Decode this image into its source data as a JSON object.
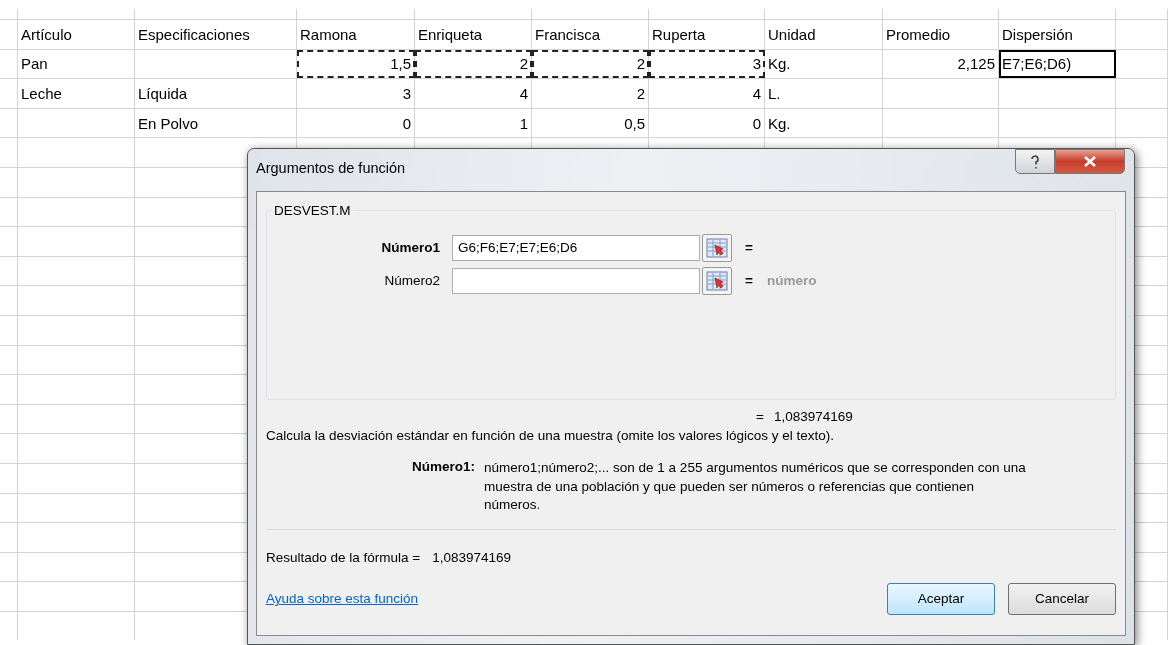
{
  "sheet": {
    "rows": [
      {
        "cells": [
          {
            "text": "Artículo",
            "kind": "text",
            "marked": false,
            "active": false
          },
          {
            "text": "Especificaciones",
            "kind": "text",
            "marked": false,
            "active": false
          },
          {
            "text": "Ramona",
            "kind": "text",
            "marked": false,
            "active": false
          },
          {
            "text": "Enriqueta",
            "kind": "text",
            "marked": false,
            "active": false
          },
          {
            "text": "Francisca",
            "kind": "text",
            "marked": false,
            "active": false
          },
          {
            "text": "Ruperta",
            "kind": "text",
            "marked": false,
            "active": false
          },
          {
            "text": "Unidad",
            "kind": "text",
            "marked": false,
            "active": false
          },
          {
            "text": "Promedio",
            "kind": "text",
            "marked": false,
            "active": false
          },
          {
            "text": "Dispersión",
            "kind": "text",
            "marked": false,
            "active": false
          }
        ]
      },
      {
        "cells": [
          {
            "text": "Pan",
            "kind": "text",
            "marked": false,
            "active": false
          },
          {
            "kind": "empty",
            "marked": false,
            "active": false
          },
          {
            "text": "1,5",
            "kind": "number",
            "marked": true,
            "active": false
          },
          {
            "text": "2",
            "kind": "number",
            "marked": true,
            "active": false
          },
          {
            "text": "2",
            "kind": "number",
            "marked": true,
            "active": false
          },
          {
            "text": "3",
            "kind": "number",
            "marked": true,
            "active": false
          },
          {
            "text": "Kg.",
            "kind": "text",
            "marked": false,
            "active": false
          },
          {
            "text": "2,125",
            "kind": "number",
            "marked": false,
            "active": false
          },
          {
            "text": "E7;E6;D6)",
            "kind": "text",
            "marked": false,
            "active": true
          }
        ]
      },
      {
        "cells": [
          {
            "text": "Leche",
            "kind": "text",
            "marked": false,
            "active": false
          },
          {
            "text": "Líquida",
            "kind": "text",
            "marked": false,
            "active": false
          },
          {
            "text": "3",
            "kind": "number",
            "marked": false,
            "active": false
          },
          {
            "text": "4",
            "kind": "number",
            "marked": false,
            "active": false
          },
          {
            "text": "2",
            "kind": "number",
            "marked": false,
            "active": false
          },
          {
            "text": "4",
            "kind": "number",
            "marked": false,
            "active": false
          },
          {
            "text": "L.",
            "kind": "text",
            "marked": false,
            "active": false
          },
          {
            "kind": "empty",
            "marked": false,
            "active": false
          },
          {
            "kind": "empty",
            "marked": false,
            "active": false
          }
        ]
      },
      {
        "cells": [
          {
            "kind": "empty",
            "marked": false,
            "active": false
          },
          {
            "text": "En Polvo",
            "kind": "text",
            "marked": false,
            "active": false
          },
          {
            "text": "0",
            "kind": "number",
            "marked": false,
            "active": false
          },
          {
            "text": "1",
            "kind": "number",
            "marked": false,
            "active": false
          },
          {
            "text": "0,5",
            "kind": "number",
            "marked": false,
            "active": false
          },
          {
            "text": "0",
            "kind": "number",
            "marked": false,
            "active": false
          },
          {
            "text": "Kg.",
            "kind": "text",
            "marked": false,
            "active": false
          },
          {
            "kind": "empty",
            "marked": false,
            "active": false
          },
          {
            "kind": "empty",
            "marked": false,
            "active": false
          }
        ]
      }
    ]
  },
  "dialog": {
    "title": "Argumentos de función",
    "function_name": "DESVEST.M",
    "arguments": [
      {
        "label": "Número1",
        "value": "G6;F6;E7;E7;E6;D6",
        "current": true,
        "equals": "="
      },
      {
        "label": "Número2",
        "current": false,
        "equals": "=",
        "hint": "número"
      }
    ],
    "result_line": {
      "equals": "=",
      "value": "1,083974169"
    },
    "description": "Calcula la desviación estándar en función de una muestra (omite los valores lógicos y el texto).",
    "argument_help": {
      "label": "Número1:",
      "text": "número1;número2;... son de 1 a 255 argumentos numéricos que se corresponden con una muestra de una población y que pueden ser números o referencias que contienen números."
    },
    "formula_result": {
      "label": "Resultado de la fórmula =",
      "value": "1,083974169"
    },
    "help_link": "Ayuda sobre esta función",
    "buttons": [
      {
        "label": "Aceptar",
        "default": true
      },
      {
        "label": "Cancelar",
        "default": false
      }
    ]
  }
}
